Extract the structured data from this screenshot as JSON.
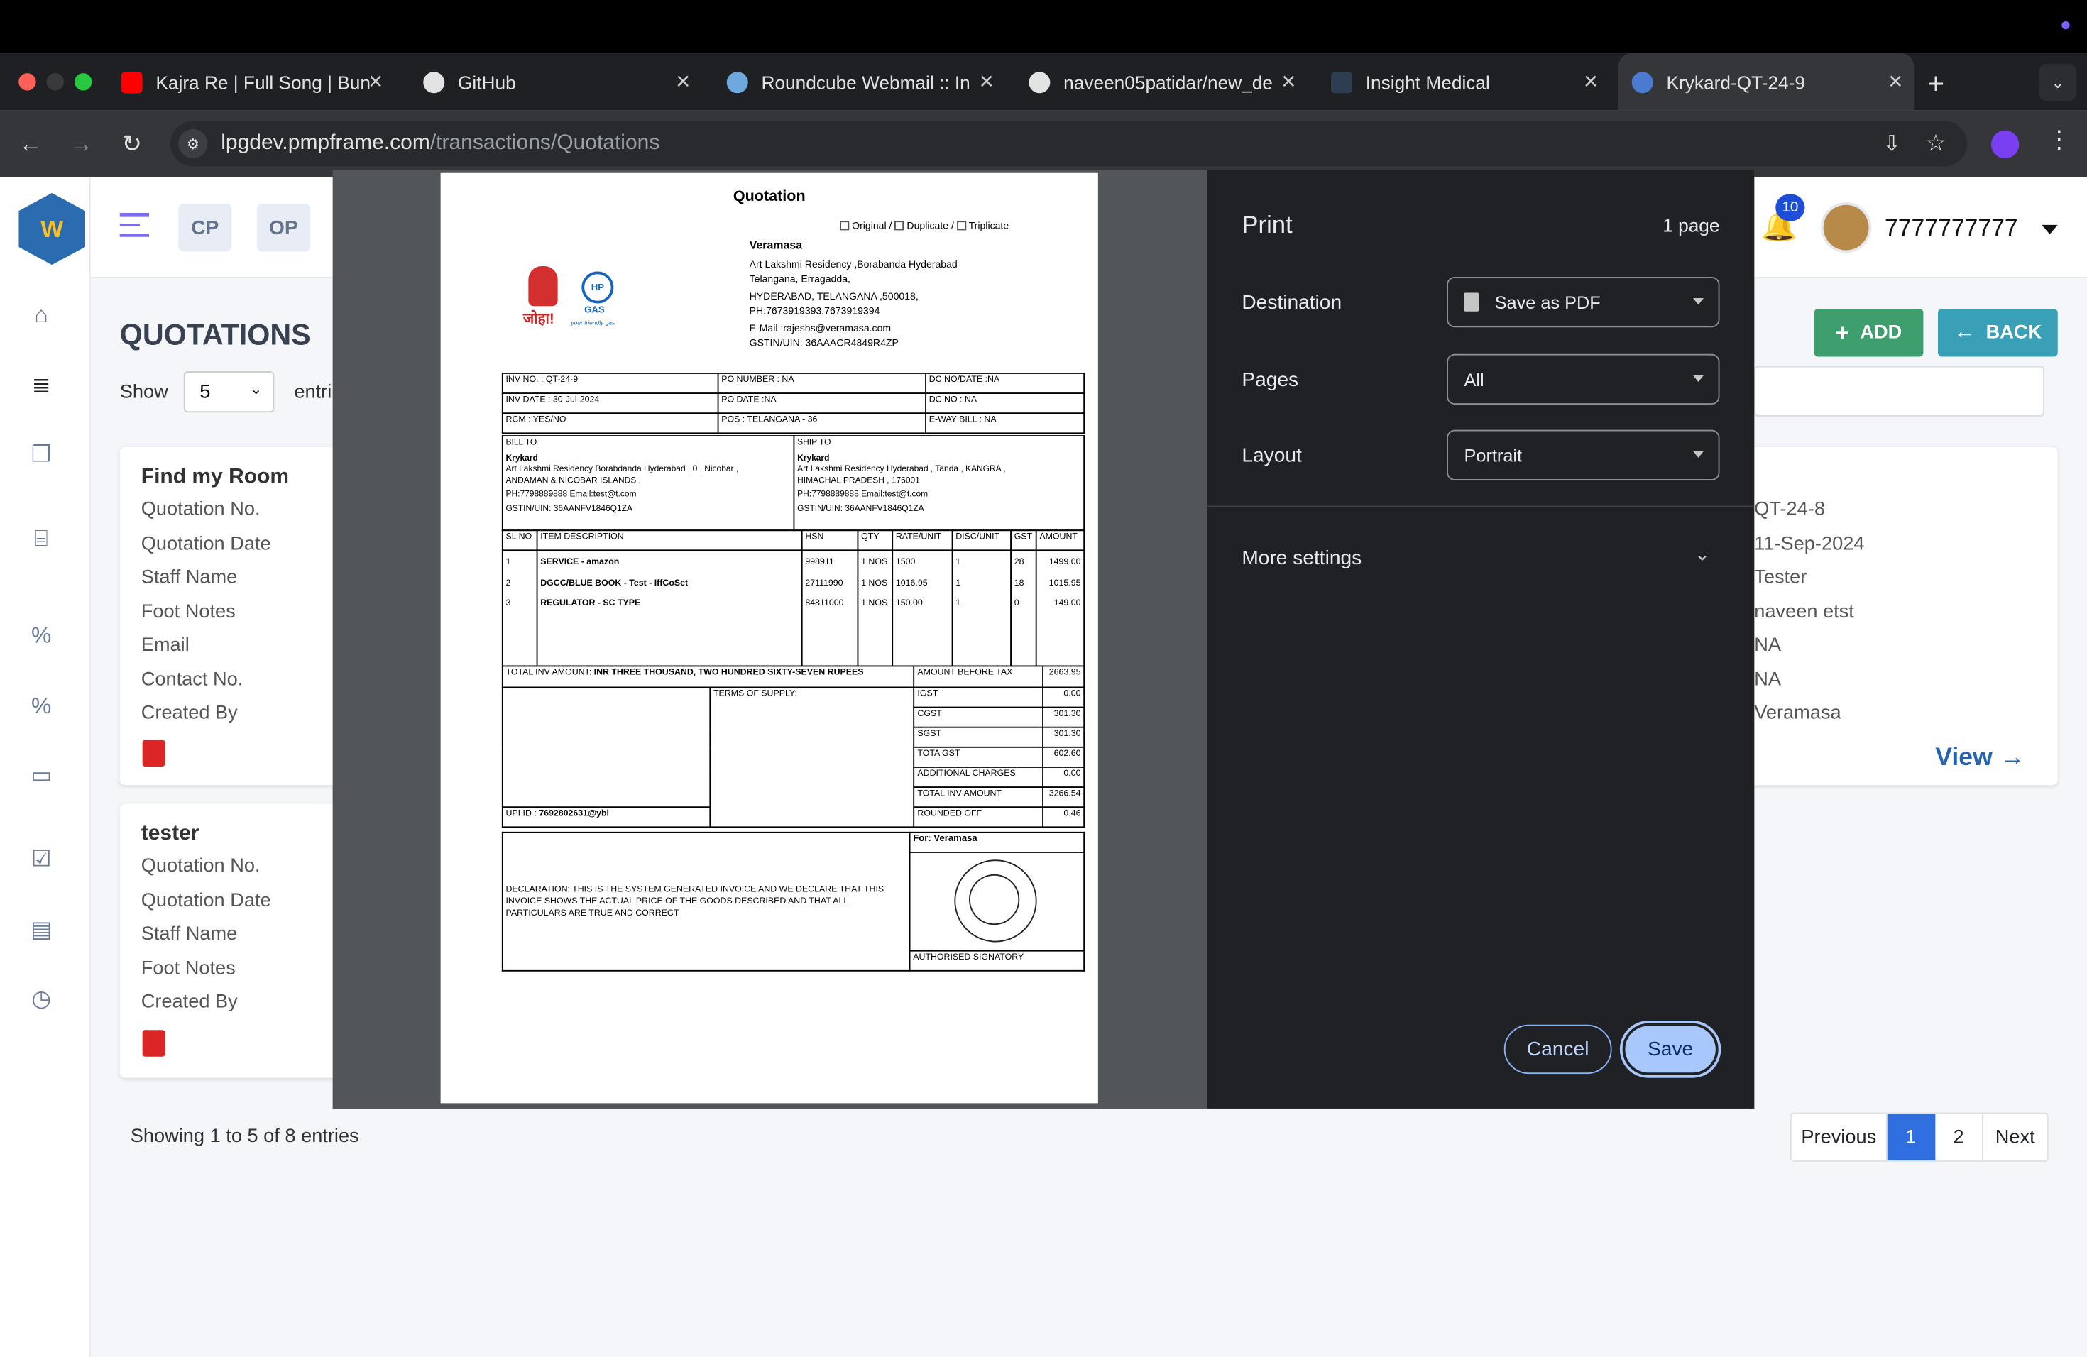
{
  "browser": {
    "tabs": [
      {
        "title": "Kajra Re | Full Song | Bun",
        "color": "#ff0000"
      },
      {
        "title": "GitHub",
        "color": "#e3e3e3"
      },
      {
        "title": "Roundcube Webmail :: In",
        "color": "#6fa8dc"
      },
      {
        "title": "naveen05patidar/new_de",
        "color": "#e3e3e3"
      },
      {
        "title": "Insight Medical",
        "color": "#2d3e50"
      },
      {
        "title": "Krykard-QT-24-9",
        "color": "#4a7bd0"
      }
    ],
    "new_tab": "+",
    "url_host": "lpgdev.pmpframe.com",
    "url_path": "/transactions/Quotations"
  },
  "header": {
    "cp": "CP",
    "op": "OP",
    "notif_count": "10",
    "user": "7777777777"
  },
  "page": {
    "title": "QUOTATIONS",
    "show_label": "Show",
    "show_value": "5",
    "entries_label": "entri",
    "add_label": "ADD",
    "back_label": "BACK",
    "view_label": "View",
    "showing": "Showing 1 to 5 of 8 entries",
    "pager": {
      "prev": "Previous",
      "p1": "1",
      "p2": "2",
      "next": "Next"
    }
  },
  "cards": [
    {
      "name": "Find my Room",
      "fields": [
        "Quotation No.",
        "Quotation Date",
        "Staff Name",
        "Foot Notes",
        "Email",
        "Contact No.",
        "Created By"
      ]
    },
    {
      "name": "tester",
      "fields": [
        "Quotation No.",
        "Quotation Date",
        "Staff Name",
        "Foot Notes",
        "Created By"
      ]
    }
  ],
  "right_card": {
    "values": [
      "QT-24-8",
      "11-Sep-2024",
      "Tester",
      "naveen etst",
      "NA",
      "NA",
      "Veramasa"
    ]
  },
  "print": {
    "title": "Print",
    "pages_count": "1 page",
    "destination_label": "Destination",
    "destination_value": "Save as PDF",
    "pages_label": "Pages",
    "pages_value": "All",
    "layout_label": "Layout",
    "layout_value": "Portrait",
    "more_settings": "More settings",
    "cancel": "Cancel",
    "save": "Save"
  },
  "invoice": {
    "title": "Quotation",
    "copies": [
      "Original",
      "Duplicate",
      "Triplicate"
    ],
    "seller": "Veramasa",
    "seller_lines": [
      "Art Lakshmi Residency ,Borabanda Hyderabad",
      "Telangana, Erragadda,",
      "HYDERABAD, TELANGANA ,500018,",
      "PH:7673919393,7673919394",
      "E-Mail :rajeshs@veramasa.com",
      "GSTIN/UIN: 36AAACR4849R4ZP"
    ],
    "logo_text": "जोहा!",
    "logo_tag": "your friendly gas",
    "logo_hp": "HP",
    "logo_gas": "GAS",
    "meta": [
      [
        "INV NO. : QT-24-9",
        "PO NUMBER : NA",
        "DC NO/DATE :NA"
      ],
      [
        "INV DATE : 30-Jul-2024",
        "PO DATE :NA",
        "DC NO : NA"
      ],
      [
        "RCM : YES/NO",
        "POS : TELANGANA - 36",
        "E-WAY BILL : NA"
      ]
    ],
    "bill_to_label": "BILL TO",
    "ship_to_label": "SHIP TO",
    "bill_name": "Krykard",
    "bill_lines": [
      "Art Lakshmi Residency Borabdanda Hyderabad , 0 , Nicobar ,",
      "ANDAMAN & NICOBAR ISLANDS ,",
      "PH:7798889888 Email:test@t.com",
      "GSTIN/UIN: 36AANFV1846Q1ZA"
    ],
    "ship_name": "Krykard",
    "ship_lines": [
      "Art Lakshmi Residency Hyderabad , Tanda , KANGRA ,",
      "HIMACHAL PRADESH , 176001",
      "PH:7798889888 Email:test@t.com",
      "GSTIN/UIN: 36AANFV1846Q1ZA"
    ],
    "item_headers": [
      "SL NO",
      "ITEM DESCRIPTION",
      "HSN",
      "QTY",
      "RATE/UNIT",
      "DISC/UNIT",
      "GST",
      "AMOUNT"
    ],
    "items": [
      [
        "1",
        "SERVICE - amazon",
        "998911",
        "1 NOS",
        "1500",
        "1",
        "28",
        "1499.00"
      ],
      [
        "2",
        "DGCC/BLUE BOOK - Test - IffCoSet",
        "27111990",
        "1 NOS",
        "1016.95",
        "1",
        "18",
        "1015.95"
      ],
      [
        "3",
        "REGULATOR - SC TYPE",
        "84811000",
        "1 NOS",
        "150.00",
        "1",
        "0",
        "149.00"
      ]
    ],
    "total_label": "TOTAL INV AMOUNT:",
    "total_words": "INR THREE THOUSAND, TWO HUNDRED SIXTY-SEVEN RUPEES",
    "terms": "TERMS OF SUPPLY:",
    "upi_label": "UPI ID :",
    "upi": "7692802631@ybl",
    "totals": [
      [
        "AMOUNT BEFORE TAX",
        "2663.95"
      ],
      [
        "IGST",
        "0.00"
      ],
      [
        "CGST",
        "301.30"
      ],
      [
        "SGST",
        "301.30"
      ],
      [
        "TOTA GST",
        "602.60"
      ],
      [
        "ADDITIONAL CHARGES",
        "0.00"
      ],
      [
        "TOTAL INV AMOUNT",
        "3266.54"
      ],
      [
        "ROUNDED OFF",
        "0.46"
      ]
    ],
    "declaration": "DECLARATION: THIS IS THE SYSTEM GENERATED INVOICE AND WE DECLARE THAT THIS INVOICE SHOWS THE ACTUAL PRICE OF THE GOODS DESCRIBED AND THAT ALL PARTICULARS ARE TRUE AND CORRECT",
    "for_label": "For: Veramasa",
    "signatory": "AUTHORISED SIGNATORY"
  }
}
